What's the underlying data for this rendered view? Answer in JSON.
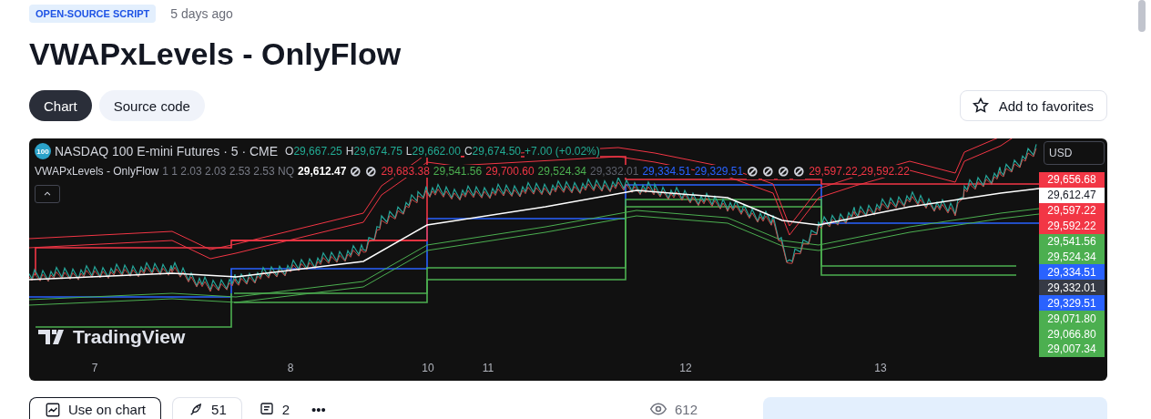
{
  "badge": "OPEN-SOURCE SCRIPT",
  "posted": "5 days ago",
  "title": "VWAPxLevels - OnlyFlow",
  "tabs": [
    {
      "label": "Chart",
      "selected": true
    },
    {
      "label": "Source code",
      "selected": false
    }
  ],
  "favorites_button": "Add to favorites",
  "chart": {
    "symbol_badge": "100",
    "symbol": "NASDAQ 100 E-mini Futures · 5 · CME",
    "ohlc": [
      {
        "key": "O",
        "value": "29,667.25"
      },
      {
        "key": "H",
        "value": "29,674.75"
      },
      {
        "key": "L",
        "value": "29,662.00"
      },
      {
        "key": "C",
        "value": "29,674.50"
      }
    ],
    "change": "+7.00 (+0.02%)",
    "indicator": {
      "name": "VWAPxLevels - OnlyFlow",
      "params": "1 1 2.03 2.03 2.53 2.53 NQ",
      "values": [
        {
          "text": "29,612.47",
          "color": "#ffffff"
        },
        {
          "text": "⊘",
          "color": "#d1d4dc"
        },
        {
          "text": "⊘",
          "color": "#d1d4dc"
        },
        {
          "text": "29,683.38",
          "color": "#f23645"
        },
        {
          "text": "29,541.56",
          "color": "#4caf50"
        },
        {
          "text": "29,700.60",
          "color": "#f23645"
        },
        {
          "text": "29,524.34",
          "color": "#4caf50"
        },
        {
          "text": "29,332.01",
          "color": "#5d606b"
        },
        {
          "text": "29,334.51",
          "color": "#2962ff"
        },
        {
          "text": "29,329.51",
          "color": "#2962ff"
        },
        {
          "text": "⊘",
          "color": "#d1d4dc"
        },
        {
          "text": "⊘",
          "color": "#d1d4dc"
        },
        {
          "text": "⊘",
          "color": "#d1d4dc"
        },
        {
          "text": "⊘",
          "color": "#d1d4dc"
        },
        {
          "text": "29,597.22",
          "color": "#f23645"
        },
        {
          "text": "29,592.22",
          "color": "#f23645"
        }
      ]
    },
    "currency": "USD",
    "price_tags": [
      {
        "text": "29,656.68",
        "color": "#f23645"
      },
      {
        "text": "29,612.47",
        "color": "#ffffff"
      },
      {
        "text": "29,597.22",
        "color": "#f23645"
      },
      {
        "text": "29,592.22",
        "color": "#f23645"
      },
      {
        "text": "29,541.56",
        "color": "#4caf50"
      },
      {
        "text": "29,524.34",
        "color": "#4caf50"
      },
      {
        "text": "29,334.51",
        "color": "#2962ff"
      },
      {
        "text": "29,332.01",
        "color": "#363a45"
      },
      {
        "text": "29,329.51",
        "color": "#2962ff"
      },
      {
        "text": "29,071.80",
        "color": "#4caf50"
      },
      {
        "text": "29,066.80",
        "color": "#4caf50"
      },
      {
        "text": "29,007.34",
        "color": "#4caf50"
      }
    ],
    "watermark": "TradingView",
    "time_labels": [
      "7",
      "8",
      "10",
      "11",
      "12",
      "13"
    ]
  },
  "actions": {
    "use_on_chart": "Use on chart",
    "boosts": "51",
    "comments": "2",
    "more": "•••",
    "views": "612"
  }
}
